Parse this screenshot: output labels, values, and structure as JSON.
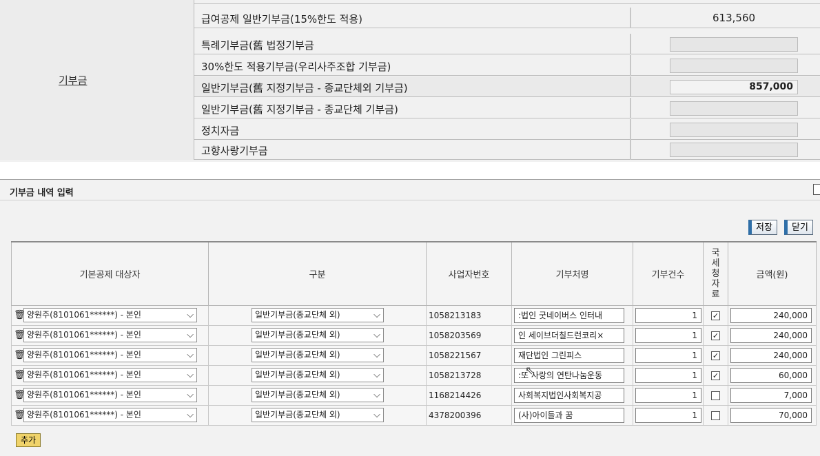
{
  "top": {
    "category": "기부금",
    "rows": [
      {
        "label": "급여공제 일반기부금(15%한도 적용)",
        "value": "613,560"
      },
      {
        "label": "특례기부금(舊 법정기부금",
        "value": ""
      },
      {
        "label": "30%한도 적용기부금(우리사주조합 기부금)",
        "value": ""
      },
      {
        "label": "일반기부금(舊 지정기부금 - 종교단체외 기부금)",
        "value": "857,000"
      },
      {
        "label": "일반기부금(舊 지정기부금 - 종교단체 기부금)",
        "value": ""
      },
      {
        "label": "정치자금",
        "value": ""
      },
      {
        "label": "고향사랑기부금",
        "value": ""
      }
    ]
  },
  "panel": {
    "title": "기부금 내역 입력",
    "save_label": "저장",
    "close_label": "닫기",
    "add_label": "추가"
  },
  "table": {
    "headers": {
      "target": "기본공제 대상자",
      "category": "구분",
      "bizno": "사업자번호",
      "donee": "기부처명",
      "count": "기부건수",
      "nts": "국\n세\n청\n자\n료",
      "amount": "금액(원)"
    },
    "rows": [
      {
        "target": "양원주(8101061******) - 본인",
        "category": "일반기부금(종교단체 외)",
        "bizno": "1058213183",
        "donee": ":법인 굿네이버스 인터내",
        "count": "1",
        "nts": true,
        "amount": "240,000"
      },
      {
        "target": "양원주(8101061******) - 본인",
        "category": "일반기부금(종교단체 외)",
        "bizno": "1058203569",
        "donee": "인 세이브더칠드런코리×",
        "count": "1",
        "nts": true,
        "amount": "240,000"
      },
      {
        "target": "양원주(8101061******) - 본인",
        "category": "일반기부금(종교단체 외)",
        "bizno": "1058221567",
        "donee": "재단법인 그린피스",
        "count": "1",
        "nts": true,
        "amount": "240,000"
      },
      {
        "target": "양원주(8101061******) - 본인",
        "category": "일반기부금(종교단체 외)",
        "bizno": "1058213728",
        "donee": ":또 사랑의 연탄나눔운동",
        "count": "1",
        "nts": true,
        "amount": "60,000"
      },
      {
        "target": "양원주(8101061******) - 본인",
        "category": "일반기부금(종교단체 외)",
        "bizno": "1168214426",
        "donee": "사회복지법인사회복지공",
        "count": "1",
        "nts": false,
        "amount": "7,000"
      },
      {
        "target": "양원주(8101061******) - 본인",
        "category": "일반기부금(종교단체 외)",
        "bizno": "4378200396",
        "donee": "(사)아이들과 꿈",
        "count": "1",
        "nts": false,
        "amount": "70,000"
      }
    ]
  },
  "icons": {
    "trash": "trash-icon",
    "chevron": "chevron-down-icon",
    "check": "check-icon"
  }
}
